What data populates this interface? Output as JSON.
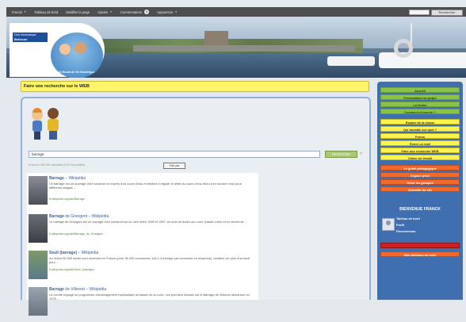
{
  "adminbar": {
    "items": [
      {
        "label": "Franck",
        "has_arrow": true
      },
      {
        "label": "Tableau de bord",
        "has_arrow": false
      },
      {
        "label": "Modifier la page",
        "has_arrow": false
      },
      {
        "label": "Ajouter",
        "has_arrow": true
      },
      {
        "label": "Commentaires",
        "has_arrow": false,
        "badge": "0"
      },
      {
        "label": "Apparence",
        "has_arrow": true
      }
    ],
    "search_button": "Rechercher"
  },
  "header": {
    "logo_badge_line1": "Club Informatique",
    "logo_badge_line2": "Bellevue",
    "logo_subtitle": "Les Bouts de Vie Numérique"
  },
  "page": {
    "title": "Faire une recherche sur le WEB"
  },
  "search": {
    "query": "barrage",
    "button": "Rechercher",
    "clear": "×",
    "result_info": "Environ 138 000 résultats (0,33 secondes)",
    "sort_label": "Trier par"
  },
  "results": [
    {
      "title_bold": "Barrage",
      "title_rest": " – Wikipédia",
      "snippet": "Un barrage est un ouvrage d'art construit en travers d'un cours d'eau et destiné à réguler le débit du cours d'eau et/ou à en stocker l'eau pour différents usages ...",
      "url": "fr.wikipedia.org/wiki/Barrage"
    },
    {
      "title_bold": "Barrage",
      "title_rest": " de Grangent – Wikipédia",
      "snippet": "Le barrage de Grangent est un ouvrage d'art construit sur la Loire entre 1955 et 1957, en aval de Aurec-sur-Loire (Haute-Loire) et en amont de ...",
      "url": "fr.wikipedia.org/wiki/Barrage_de_Grangent"
    },
    {
      "title_bold": "Seuil (barrage)",
      "title_rest": " – Wikipédia",
      "snippet": "Au moins 60 000 seuils sont recensés en France (pour 36 000 communes, soit 1,4 barrage par commune en moyenne), certains ont plus d'un seuil pour ...",
      "url": "fr.wikipedia.org/wiki/Seuil_(barrage)"
    },
    {
      "title_bold": "Barrage",
      "title_rest": " de Villerest – Wikipédia",
      "snippet": "Le comité engagé un programme d'aménagement hydraulique du bassin de la Loire. Les premiers travaux sur le Barrage de Villerest démarrent en 1978 ...",
      "url": ""
    }
  ],
  "sidebar": {
    "green_items": [
      "Accueil",
      "Présentation du projet",
      "La fiction",
      "Comment s'inscrire ?"
    ],
    "yellow_items": [
      "Espace de la classe",
      "Qui travaille sur quoi ?",
      "Forum",
      "Écrire un mail",
      "Faire une recherche WEB",
      "Cahier de travail"
    ],
    "orange_items": [
      "Le guide pédagogique",
      "Espace privé",
      "Gérer les groupes",
      "Actualité du site"
    ],
    "welcome": "BIENVENUE FRANCK",
    "user_links": [
      "Tableau de bord",
      "Profil",
      "Déconnexion"
    ],
    "bottom_item": "Mes tableaux de bord"
  },
  "colors": {
    "green": "#8bc34a",
    "yellow": "#fff34f",
    "orange": "#f06a2e",
    "sidebar": "#3f6fae",
    "link": "#3465a4"
  }
}
